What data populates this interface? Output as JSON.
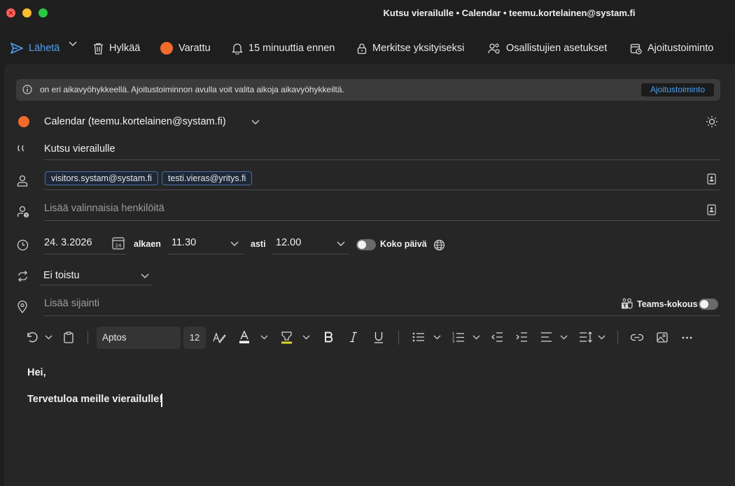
{
  "window": {
    "title": "Kutsu vierailulle • Calendar • teemu.kortelainen@systam.fi"
  },
  "toolbar": {
    "send": "Lähetä",
    "discard": "Hylkää",
    "busy": "Varattu",
    "reminder": "15 minuuttia ennen",
    "private": "Merkitse yksityiseksi",
    "attendee_settings": "Osallistujien asetukset",
    "scheduling": "Ajoitustoiminto",
    "accent_color": "#4ea1f3",
    "busy_color": "#f26b2a"
  },
  "infobar": {
    "text": "on eri aikavyöhykkeellä. Ajoitustoiminnon avulla voit valita aikoja aikavyöhykkeiltä.",
    "button": "Ajoitustoiminto"
  },
  "event": {
    "calendar": "Calendar (teemu.kortelainen@systam.fi)",
    "calendar_color": "#f26b2a",
    "title": "Kutsu vierailulle",
    "required_attendees": [
      "visitors.systam@systam.fi",
      "testi.vieras@yritys.fi"
    ],
    "optional_placeholder": "Lisää valinnaisia henkilöitä",
    "date": "24. 3.2026",
    "calendar_day": "24",
    "from_label": "alkaen",
    "start_time": "11.30",
    "to_label": "asti",
    "end_time": "12.00",
    "all_day_label": "Koko päivä",
    "all_day": false,
    "recurrence": "Ei toistu",
    "location_placeholder": "Lisää sijainti",
    "teams_label": "Teams-kokous",
    "teams": false
  },
  "format": {
    "font": "Aptos",
    "size": "12"
  },
  "body": {
    "greeting": "Hei,",
    "line": "Tervetuloa meille vierailulle!"
  }
}
